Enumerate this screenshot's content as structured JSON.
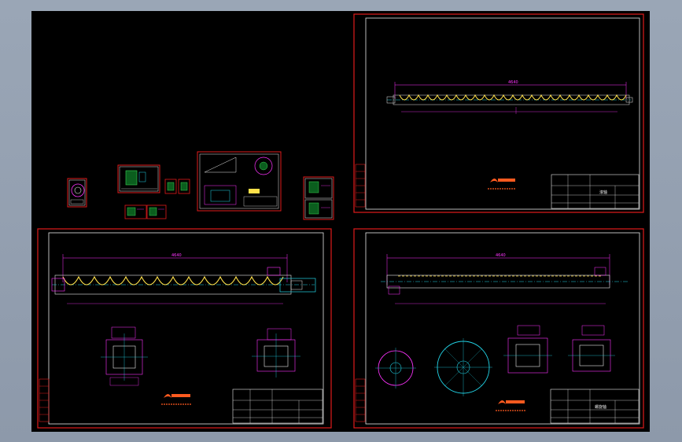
{
  "sheets": {
    "top_right": {
      "label": "滚轴",
      "dimension_total": "4640"
    },
    "bottom_left": {
      "dimension_total": "4640"
    },
    "bottom_right": {
      "dimension_total": "4640",
      "label": "螺旋轴"
    }
  },
  "colors": {
    "viewport": "#000000",
    "frame": "#e01b1b",
    "inner_border": "#e8e8e8",
    "dimension": "#ff33ff",
    "helix": "#ffe14a",
    "centerline": "#22d3e6"
  }
}
